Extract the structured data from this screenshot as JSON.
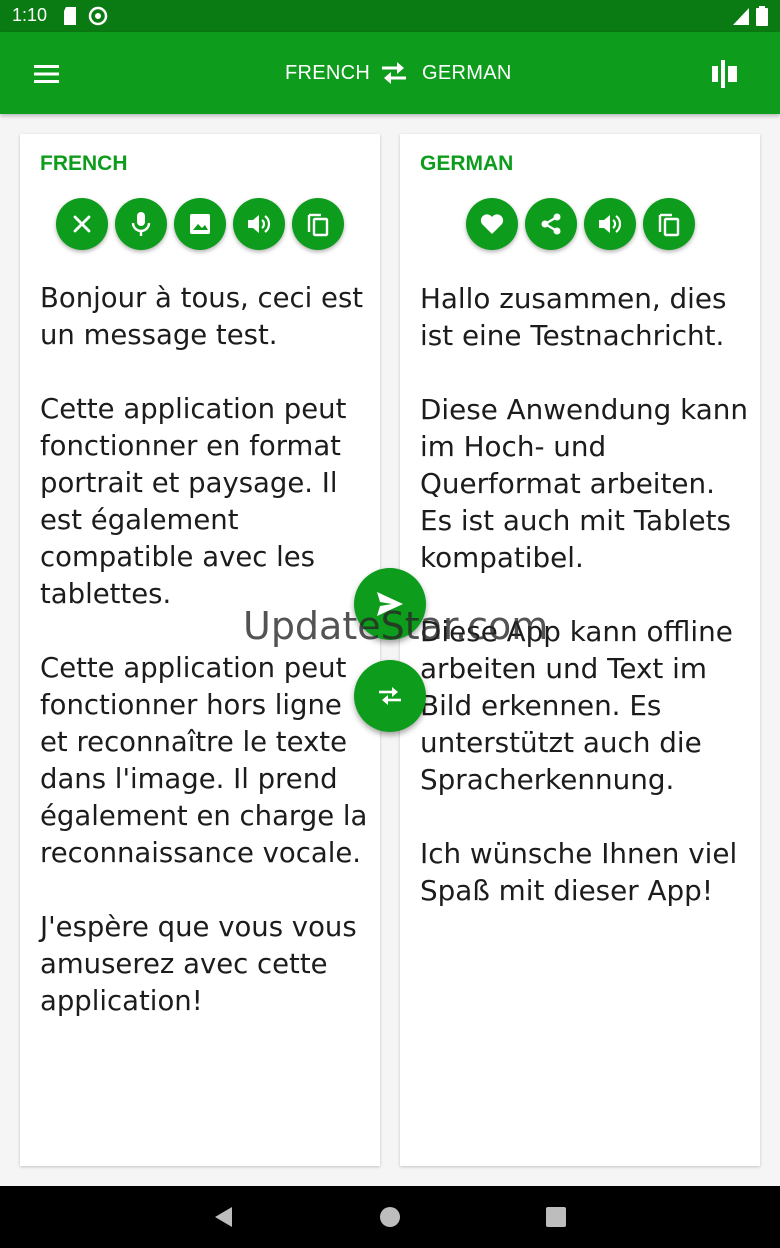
{
  "status_bar": {
    "time": "1:10",
    "icons": [
      "sd-card-icon",
      "sync-icon",
      "signal-icon",
      "battery-icon"
    ]
  },
  "app_bar": {
    "menu_icon": "menu-icon",
    "source_language": "FRENCH",
    "swap_icon": "swap-icon",
    "target_language": "GERMAN",
    "layout_icon": "split-view-icon"
  },
  "source_panel": {
    "language": "FRENCH",
    "actions": [
      "clear-icon",
      "microphone-icon",
      "image-icon",
      "speaker-icon",
      "copy-icon"
    ],
    "text": "Bonjour à tous, ceci est un message test.\n\nCette application peut fonctionner en format portrait et paysage. Il est également compatible avec les tablettes.\n\nCette application peut fonctionner hors ligne et reconnaître le texte dans l'image. Il prend également en charge la reconnaissance vocale.\n\nJ'espère que vous vous amuserez avec cette application!"
  },
  "target_panel": {
    "language": "GERMAN",
    "actions": [
      "favorite-icon",
      "share-icon",
      "speaker-icon",
      "copy-icon"
    ],
    "text": "Hallo zusammen, dies ist eine Testnachricht.\n\nDiese Anwendung kann im Hoch- und Querformat arbeiten. Es ist auch mit Tablets kompatibel.\n\nDiese App kann offline arbeiten und Text im Bild erkennen. Es unterstützt auch die Spracherkennung.\n\nIch wünsche Ihnen viel Spaß mit dieser App!"
  },
  "floating_buttons": [
    "send-icon",
    "swap-icon"
  ],
  "watermark": "UpdateStar.com",
  "nav_bar": [
    "back-icon",
    "home-icon",
    "recents-icon"
  ],
  "colors": {
    "primary": "#0e9c1c",
    "status_bar": "#0a7a12",
    "background": "#f5f5f5"
  }
}
